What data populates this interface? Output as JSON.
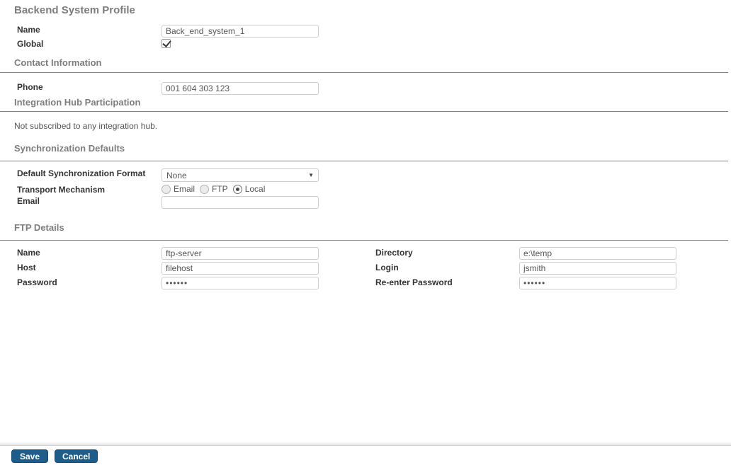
{
  "page": {
    "title": "Backend System Profile"
  },
  "general": {
    "name": {
      "label": "Name",
      "value": "Back_end_system_1"
    },
    "global": {
      "label": "Global",
      "checked": true
    }
  },
  "contact": {
    "header": "Contact Information",
    "phone": {
      "label": "Phone",
      "value": "001 604 303 123"
    }
  },
  "integration_hub": {
    "header": "Integration Hub Participation",
    "status_text": "Not subscribed to any integration hub."
  },
  "sync_defaults": {
    "header": "Synchronization Defaults",
    "format": {
      "label": "Default Synchronization Format",
      "value": "None"
    },
    "transport": {
      "label": "Transport Mechanism",
      "options": [
        {
          "label": "Email",
          "selected": false
        },
        {
          "label": "FTP",
          "selected": false
        },
        {
          "label": "Local",
          "selected": true
        }
      ]
    },
    "email": {
      "label": "Email",
      "value": ""
    }
  },
  "ftp_details": {
    "header": "FTP Details",
    "left": [
      {
        "label": "Name",
        "value": "ftp-server"
      },
      {
        "label": "Host",
        "value": "filehost"
      },
      {
        "label": "Password",
        "value": "••••••"
      }
    ],
    "right": [
      {
        "label": "Directory",
        "value": "e:\\temp"
      },
      {
        "label": "Login",
        "value": "jsmith"
      },
      {
        "label": "Re-enter Password",
        "value": "••••••"
      }
    ]
  },
  "footer": {
    "save_label": "Save",
    "cancel_label": "Cancel"
  },
  "colors": {
    "button_bg": "#1e5c8a",
    "section_header": "#7d7d7d",
    "label": "#333333",
    "rule": "#828282",
    "input_border": "#cccccc"
  }
}
